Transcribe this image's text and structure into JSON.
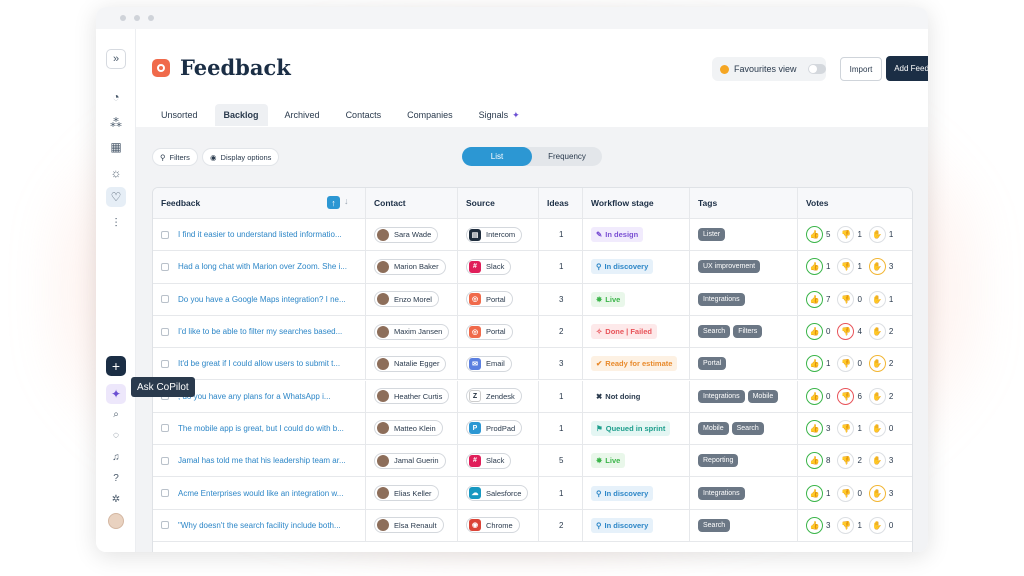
{
  "page": {
    "title": "Feedback"
  },
  "sidebar": {
    "icons": [
      "expand-icon",
      "dashboard-icon",
      "integrations-icon",
      "grid-icon",
      "idea-icon",
      "feedback-icon",
      "roadmap-icon"
    ],
    "bottom": [
      "add-icon",
      "copilot-icon",
      "search-icon",
      "chat-icon",
      "bell-icon",
      "help-icon",
      "settings-icon"
    ],
    "tooltip": "Ask CoPilot"
  },
  "header": {
    "favourites_label": "Favourites view",
    "import_label": "Import",
    "add_label": "Add Feedback"
  },
  "tabs": [
    "Unsorted",
    "Backlog",
    "Archived",
    "Contacts",
    "Companies",
    "Signals"
  ],
  "toolbar": {
    "filters_label": "Filters",
    "display_label": "Display options",
    "view_list": "List",
    "view_frequency": "Frequency"
  },
  "columns": [
    "Feedback",
    "Contact",
    "Source",
    "Ideas",
    "Workflow stage",
    "Tags",
    "Votes"
  ],
  "rows": [
    {
      "feedback": "I find it easier to understand listed informatio...",
      "contact": "Sara Wade",
      "source": "Intercom",
      "ideas": "1",
      "stage": "In design",
      "tags": [
        "Lister"
      ],
      "up": "5",
      "down": "1",
      "mid": "1",
      "hot_down": false,
      "hot_mid": false
    },
    {
      "feedback": "Had a long chat with Marion over Zoom. She i...",
      "contact": "Marion Baker",
      "source": "Slack",
      "ideas": "1",
      "stage": "In discovery",
      "tags": [
        "UX improvement"
      ],
      "up": "1",
      "down": "1",
      "mid": "3",
      "hot_down": false,
      "hot_mid": true
    },
    {
      "feedback": "Do you have a Google Maps integration? I ne...",
      "contact": "Enzo Morel",
      "source": "Portal",
      "ideas": "3",
      "stage": "Live",
      "tags": [
        "Integrations"
      ],
      "up": "7",
      "down": "0",
      "mid": "1",
      "hot_down": false,
      "hot_mid": false
    },
    {
      "feedback": "I'd like to be able to filter my searches based...",
      "contact": "Maxim Jansen",
      "source": "Portal",
      "ideas": "2",
      "stage": "Done | Failed",
      "tags": [
        "Search",
        "Filters"
      ],
      "up": "0",
      "down": "4",
      "mid": "2",
      "hot_down": true,
      "hot_mid": false
    },
    {
      "feedback": "It'd be great if I could allow users to submit t...",
      "contact": "Natalie Egger",
      "source": "Email",
      "ideas": "3",
      "stage": "Ready for estimate",
      "tags": [
        "Portal"
      ],
      "up": "1",
      "down": "0",
      "mid": "2",
      "hot_down": false,
      "hot_mid": true
    },
    {
      "feedback": ", do you have any plans for a WhatsApp i...",
      "contact": "Heather Curtis",
      "source": "Zendesk",
      "ideas": "1",
      "stage": "Not doing",
      "tags": [
        "Integrations",
        "Mobile"
      ],
      "up": "0",
      "down": "6",
      "mid": "2",
      "hot_down": true,
      "hot_mid": false
    },
    {
      "feedback": "The mobile app is great, but I could do with b...",
      "contact": "Matteo Klein",
      "source": "ProdPad",
      "ideas": "1",
      "stage": "Queued in sprint",
      "tags": [
        "Mobile",
        "Search"
      ],
      "up": "3",
      "down": "1",
      "mid": "0",
      "hot_down": false,
      "hot_mid": false
    },
    {
      "feedback": "Jamal has told me that his leadership team ar...",
      "contact": "Jamal Guerin",
      "source": "Slack",
      "ideas": "5",
      "stage": "Live",
      "tags": [
        "Reporting"
      ],
      "up": "8",
      "down": "2",
      "mid": "3",
      "hot_down": false,
      "hot_mid": false
    },
    {
      "feedback": "Acme Enterprises would like an integration w...",
      "contact": "Elias Keller",
      "source": "Salesforce",
      "ideas": "1",
      "stage": "In discovery",
      "tags": [
        "Integrations"
      ],
      "up": "1",
      "down": "0",
      "mid": "3",
      "hot_down": false,
      "hot_mid": true
    },
    {
      "feedback": "\"Why doesn't the search facility include both...",
      "contact": "Elsa Renault",
      "source": "Chrome",
      "ideas": "2",
      "stage": "In discovery",
      "tags": [
        "Search"
      ],
      "up": "3",
      "down": "1",
      "mid": "0",
      "hot_down": false,
      "hot_mid": false
    }
  ],
  "colors": {
    "accent": "#2c97d3",
    "navy": "#1b2e45",
    "stage_design": "#7a4fd3",
    "stage_discovery": "#2c86c7",
    "stage_live": "#3bb54a",
    "stage_failed": "#e8545a",
    "stage_estimate": "#e88a2c",
    "stage_not": "#2a3a4d",
    "stage_queued": "#1c9e8c"
  }
}
